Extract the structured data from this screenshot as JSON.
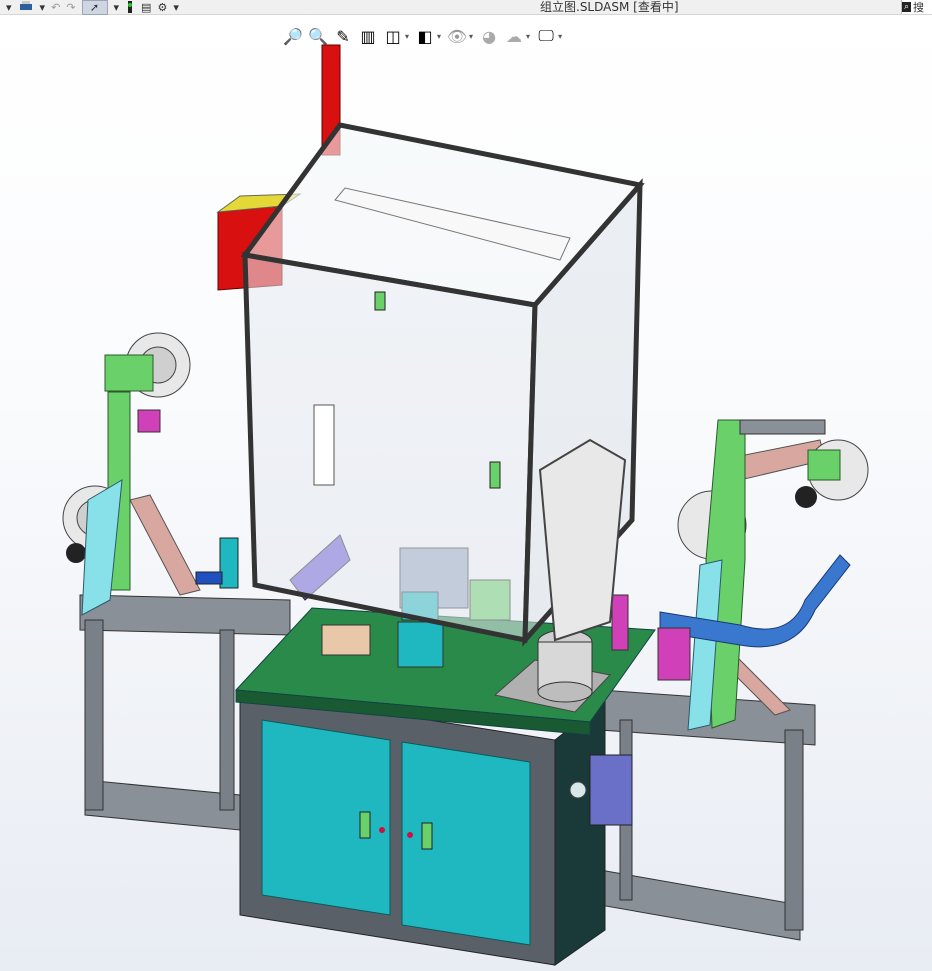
{
  "window": {
    "title": "组立图.SLDASM [查看中]"
  },
  "toolbar": {
    "items": [
      {
        "name": "print-icon"
      },
      {
        "name": "undo-icon"
      },
      {
        "name": "redo-icon"
      },
      {
        "name": "select-icon"
      },
      {
        "name": "rebuild-icon"
      },
      {
        "name": "file-properties-icon"
      },
      {
        "name": "options-icon"
      }
    ],
    "search_partial": "搜"
  },
  "view_toolbar": {
    "items": [
      "zoom-to-fit-icon",
      "zoom-to-area-icon",
      "previous-view-icon",
      "section-view-icon",
      "view-orientation-icon",
      "display-style-icon",
      "hide-show-icon",
      "edit-appearance-icon",
      "apply-scene-icon",
      "view-settings-icon"
    ]
  },
  "colors": {
    "frame": "#6e747c",
    "glass": "#e6eaee",
    "table_top": "#2a8a4a",
    "cabinet": "#1fb8c0",
    "green_post": "#6ad06a",
    "red_box": "#d81010",
    "yellow": "#e4d838",
    "blue_arm": "#3a78d0",
    "magenta": "#d040b8"
  }
}
